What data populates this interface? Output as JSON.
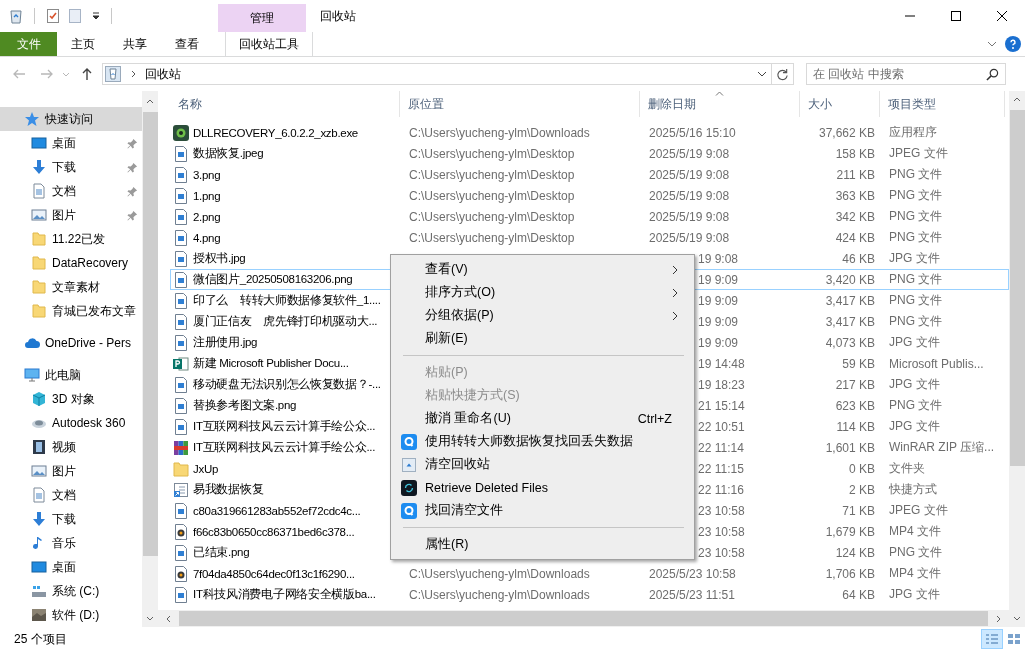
{
  "title_bar": {
    "contextual_tab": "管理",
    "title": "回收站"
  },
  "ribbon_tabs": [
    {
      "label": "文件",
      "kind": "file"
    },
    {
      "label": "主页",
      "kind": "normal"
    },
    {
      "label": "共享",
      "kind": "normal"
    },
    {
      "label": "查看",
      "kind": "normal"
    },
    {
      "label": "回收站工具",
      "kind": "contextual"
    }
  ],
  "address_bar": {
    "path": "回收站",
    "search_placeholder": "在 回收站 中搜索"
  },
  "sidebar": {
    "groups": [
      {
        "label": "快速访问",
        "kind": "star",
        "selected": true,
        "children": [
          {
            "label": "桌面",
            "kind": "desktop",
            "pinned": true,
            "selected": false
          },
          {
            "label": "下载",
            "kind": "download",
            "pinned": true,
            "selected": false
          },
          {
            "label": "文档",
            "kind": "document",
            "pinned": true,
            "selected": false
          },
          {
            "label": "图片",
            "kind": "pictures",
            "pinned": true,
            "selected": false
          },
          {
            "label": "11.22已发",
            "kind": "folder",
            "pinned": false,
            "selected": false
          },
          {
            "label": "DataRecovery",
            "kind": "folder",
            "pinned": false,
            "selected": false
          },
          {
            "label": "文章素材",
            "kind": "folder",
            "pinned": false,
            "selected": false
          },
          {
            "label": "育城已发布文章",
            "kind": "folder",
            "pinned": false,
            "selected": false
          }
        ]
      },
      {
        "label": "OneDrive - Pers",
        "kind": "cloud",
        "selected": false
      },
      {
        "label": "此电脑",
        "kind": "computer",
        "selected": false,
        "children": [
          {
            "label": "3D 对象",
            "kind": "cube",
            "pinned": false,
            "selected": false
          },
          {
            "label": "Autodesk 360",
            "kind": "ring",
            "pinned": false,
            "selected": false
          },
          {
            "label": "视频",
            "kind": "film",
            "pinned": false,
            "selected": false
          },
          {
            "label": "图片",
            "kind": "pictures",
            "pinned": false,
            "selected": false
          },
          {
            "label": "文档",
            "kind": "document",
            "pinned": false,
            "selected": false
          },
          {
            "label": "下载",
            "kind": "download",
            "pinned": false,
            "selected": false
          },
          {
            "label": "音乐",
            "kind": "music",
            "pinned": false,
            "selected": false
          },
          {
            "label": "桌面",
            "kind": "desktop",
            "pinned": false,
            "selected": false
          },
          {
            "label": "系统 (C:)",
            "kind": "drive",
            "pinned": false,
            "selected": false
          },
          {
            "label": "软件 (D:)",
            "kind": "photo-drive",
            "pinned": false,
            "selected": false
          }
        ]
      }
    ]
  },
  "table": {
    "columns": [
      {
        "label": "名称",
        "sorted": false
      },
      {
        "label": "原位置",
        "sorted": false
      },
      {
        "label": "删除日期",
        "sorted": true
      },
      {
        "label": "大小",
        "sorted": false
      },
      {
        "label": "项目类型",
        "sorted": false
      }
    ],
    "rows": [
      {
        "kind": "exe",
        "name": "DLLRECOVERY_6.0.2.2_xzb.exe",
        "location": "C:\\Users\\yucheng-ylm\\Downloads",
        "date": "2025/5/16 15:10",
        "size": "37,662 KB",
        "type": "应用程序",
        "focused": false
      },
      {
        "kind": "image",
        "name": "数据恢复.jpeg",
        "location": "C:\\Users\\yucheng-ylm\\Desktop",
        "date": "2025/5/19 9:08",
        "size": "158 KB",
        "type": "JPEG 文件",
        "focused": false
      },
      {
        "kind": "image",
        "name": "3.png",
        "location": "C:\\Users\\yucheng-ylm\\Desktop",
        "date": "2025/5/19 9:08",
        "size": "211 KB",
        "type": "PNG 文件",
        "focused": false
      },
      {
        "kind": "image",
        "name": "1.png",
        "location": "C:\\Users\\yucheng-ylm\\Desktop",
        "date": "2025/5/19 9:08",
        "size": "363 KB",
        "type": "PNG 文件",
        "focused": false
      },
      {
        "kind": "image",
        "name": "2.png",
        "location": "C:\\Users\\yucheng-ylm\\Desktop",
        "date": "2025/5/19 9:08",
        "size": "342 KB",
        "type": "PNG 文件",
        "focused": false
      },
      {
        "kind": "image",
        "name": "4.png",
        "location": "C:\\Users\\yucheng-ylm\\Desktop",
        "date": "2025/5/19 9:08",
        "size": "424 KB",
        "type": "PNG 文件",
        "focused": false
      },
      {
        "kind": "image",
        "name": "授权书.jpg",
        "date": "19 9:08",
        "size": "46 KB",
        "type": "JPG 文件",
        "focused": false
      },
      {
        "kind": "image",
        "name": "微信图片_20250508163206.png",
        "date": "19 9:09",
        "size": "3,420 KB",
        "type": "PNG 文件",
        "focused": true
      },
      {
        "kind": "image",
        "name": "印了么　转转大师数据修复软件_1....",
        "date": "19 9:09",
        "size": "3,417 KB",
        "type": "PNG 文件",
        "focused": false
      },
      {
        "kind": "image",
        "name": "厦门正信友　虎先锋打印机驱动大...",
        "date": "19 9:09",
        "size": "3,417 KB",
        "type": "PNG 文件",
        "focused": false
      },
      {
        "kind": "image",
        "name": "注册使用.jpg",
        "date": "19 9:09",
        "size": "4,073 KB",
        "type": "JPG 文件",
        "focused": false
      },
      {
        "kind": "publisher",
        "name": "新建 Microsoft Publisher Docu...",
        "date": "19 14:48",
        "size": "59 KB",
        "type": "Microsoft Publis...",
        "focused": false
      },
      {
        "kind": "image",
        "name": "移动硬盘无法识别怎么恢复数据？-...",
        "date": "19 18:23",
        "size": "217 KB",
        "type": "JPG 文件",
        "focused": false
      },
      {
        "kind": "image",
        "name": "替换参考图文案.png",
        "date": "21 15:14",
        "size": "623 KB",
        "type": "PNG 文件",
        "focused": false
      },
      {
        "kind": "image",
        "name": "IT互联网科技风云云计算手绘公众...",
        "date": "22 10:51",
        "size": "114 KB",
        "type": "JPG 文件",
        "focused": false
      },
      {
        "kind": "archive",
        "name": "IT互联网科技风云云计算手绘公众...",
        "date": "22 11:14",
        "size": "1,601 KB",
        "type": "WinRAR ZIP 压缩...",
        "focused": false
      },
      {
        "kind": "folder",
        "name": "JxUp",
        "date": "22 11:15",
        "size": "0 KB",
        "type": "文件夹",
        "focused": false
      },
      {
        "kind": "shortcut",
        "name": "易我数据恢复",
        "date": "22 11:16",
        "size": "2 KB",
        "type": "快捷方式",
        "focused": false
      },
      {
        "kind": "image",
        "name": "c80a319661283ab552ef72cdc4c...",
        "date": "23 10:58",
        "size": "71 KB",
        "type": "JPEG 文件",
        "focused": false
      },
      {
        "kind": "video",
        "name": "f66c83b0650cc86371bed6c378...",
        "date": "23 10:58",
        "size": "1,679 KB",
        "type": "MP4 文件",
        "focused": false
      },
      {
        "kind": "image",
        "name": "已结束.png",
        "date": "23 10:58",
        "size": "124 KB",
        "type": "PNG 文件",
        "focused": false
      },
      {
        "kind": "video",
        "name": "7f04da4850c64dec0f13c1f6290...",
        "location": "C:\\Users\\yucheng-ylm\\Downloads",
        "date": "2025/5/23 10:58",
        "size": "1,706 KB",
        "type": "MP4 文件",
        "focused": false
      },
      {
        "kind": "image",
        "name": "IT科技风消费电子网络安全横版ba...",
        "location": "C:\\Users\\yucheng-ylm\\Downloads",
        "date": "2025/5/23 11:51",
        "size": "64 KB",
        "type": "JPG 文件",
        "focused": false
      }
    ]
  },
  "context_menu": [
    {
      "kind": "submenu",
      "label": "查看(V)",
      "disabled": false
    },
    {
      "kind": "submenu",
      "label": "排序方式(O)",
      "disabled": false
    },
    {
      "kind": "submenu",
      "label": "分组依据(P)",
      "disabled": false
    },
    {
      "kind": "command",
      "label": "刷新(E)",
      "disabled": false
    },
    {
      "kind": "separator"
    },
    {
      "kind": "command",
      "label": "粘贴(P)",
      "disabled": true
    },
    {
      "kind": "command",
      "label": "粘贴快捷方式(S)",
      "disabled": true
    },
    {
      "kind": "command",
      "label": "撤消 重命名(U)",
      "shortcut": "Ctrl+Z",
      "disabled": false
    },
    {
      "kind": "app-blue",
      "label": "使用转转大师数据恢复找回丢失数据",
      "disabled": false
    },
    {
      "kind": "recycle",
      "label": "清空回收站",
      "disabled": false
    },
    {
      "kind": "app-dark",
      "label": "Retrieve Deleted Files",
      "disabled": false
    },
    {
      "kind": "app-blue",
      "label": "找回清空文件",
      "disabled": false
    },
    {
      "kind": "separator"
    },
    {
      "kind": "command",
      "label": "属性(R)",
      "disabled": false
    }
  ],
  "status_bar": {
    "item_count": "25 个项目"
  }
}
